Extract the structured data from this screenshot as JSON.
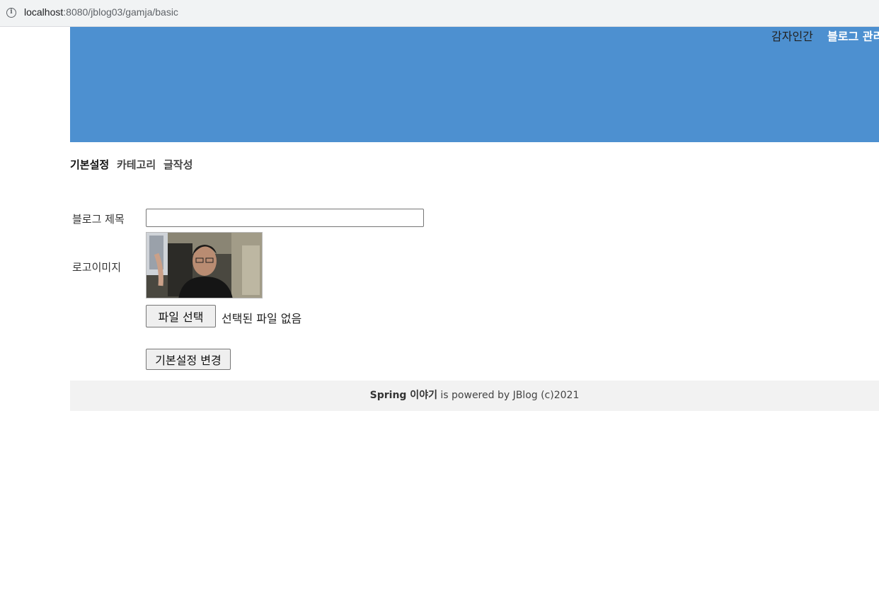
{
  "browser": {
    "url_host": "localhost",
    "url_path": ":8080/jblog03/gamja/basic"
  },
  "header": {
    "user": "감자인간",
    "admin_link": "블로그 관리"
  },
  "tabs": [
    {
      "label": "기본설정",
      "active": true
    },
    {
      "label": "카테고리",
      "active": false
    },
    {
      "label": "글작성",
      "active": false
    }
  ],
  "form": {
    "title_label": "블로그 제목",
    "title_value": "",
    "logo_label": "로고이미지",
    "file_button": "파일 선택",
    "file_status": "선택된 파일 없음",
    "submit_label": "기본설정 변경"
  },
  "footer": {
    "blog_name": "Spring 이야기",
    "rest": " is powered by JBlog (c)2021"
  },
  "colors": {
    "header_bg": "#4d90d0",
    "footer_bg": "#f2f2f2"
  }
}
